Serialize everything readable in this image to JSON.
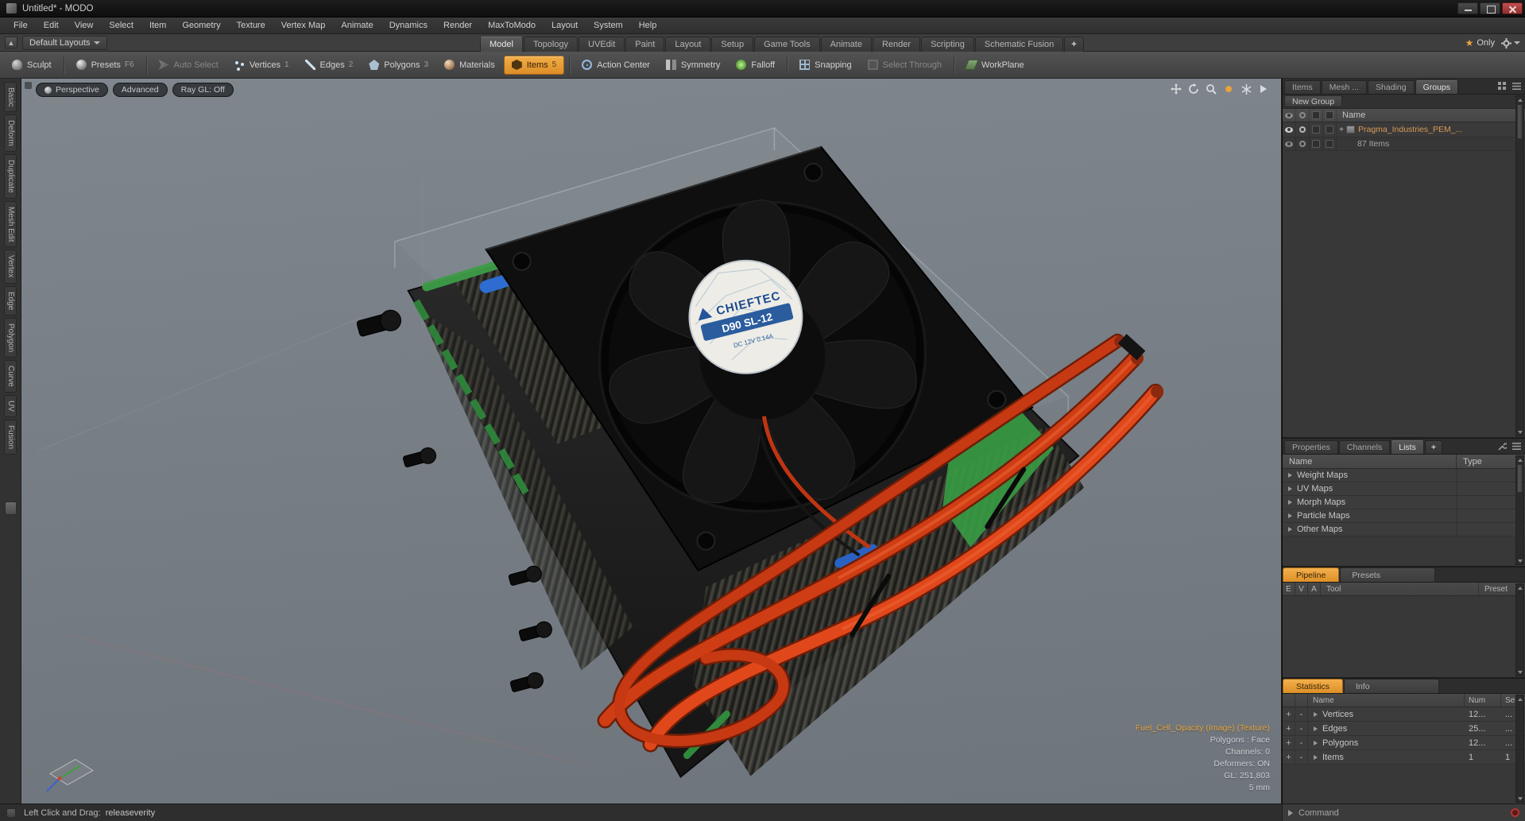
{
  "window": {
    "title": "Untitled* - MODO"
  },
  "menubar": {
    "items": [
      "File",
      "Edit",
      "View",
      "Select",
      "Item",
      "Geometry",
      "Texture",
      "Vertex Map",
      "Animate",
      "Dynamics",
      "Render",
      "MaxToModo",
      "Layout",
      "System",
      "Help"
    ]
  },
  "layoutbar": {
    "layout_selector": "Default Layouts",
    "tabs": [
      "Model",
      "Topology",
      "UVEdit",
      "Paint",
      "Layout",
      "Setup",
      "Game Tools",
      "Animate",
      "Render",
      "Scripting",
      "Schematic Fusion"
    ],
    "add_tab": "+",
    "only": "Only"
  },
  "toolbar": {
    "buttons": [
      {
        "label": "Sculpt"
      },
      {
        "label": "Presets",
        "hotkey": "F6"
      },
      {
        "label": "Auto Select"
      },
      {
        "label": "Vertices",
        "hotkey": "1"
      },
      {
        "label": "Edges",
        "hotkey": "2"
      },
      {
        "label": "Polygons",
        "hotkey": "3"
      },
      {
        "label": "Materials"
      },
      {
        "label": "Items",
        "hotkey": "5"
      },
      {
        "label": "Action Center"
      },
      {
        "label": "Symmetry"
      },
      {
        "label": "Falloff"
      },
      {
        "label": "Snapping"
      },
      {
        "label": "Select Through"
      },
      {
        "label": "WorkPlane"
      }
    ]
  },
  "left_rail": {
    "tabs": [
      "Basic",
      "Deform",
      "Duplicate",
      "Mesh Edit",
      "Vertex",
      "Edge",
      "Polygon",
      "Curve",
      "UV",
      "Fusion"
    ]
  },
  "viewport": {
    "controls": [
      "Perspective",
      "Advanced",
      "Ray GL: Off"
    ],
    "info": {
      "texture": "Fuel_Cell_Opacity (Image) (Texture)",
      "lines": [
        "Polygons : Face",
        "Channels: 0",
        "Deformers: ON",
        "GL: 251,803",
        "5 mm"
      ]
    },
    "model": {
      "fan_brand": "CHIEFTEC",
      "fan_model": "D90 SL-12",
      "fan_spec": "DC 12V 0.14A"
    }
  },
  "right_panel": {
    "groups": {
      "tabs": [
        "Items",
        "Mesh ...",
        "Shading",
        "Groups"
      ],
      "new_group": "New Group",
      "name_col": "Name",
      "expander": "+",
      "item_label": "Pragma_Industries_PEM_...",
      "item_count": "87 Items"
    },
    "lists": {
      "tabs": [
        "Properties",
        "Channels",
        "Lists"
      ],
      "add_tab": "+",
      "cols": {
        "name": "Name",
        "type": "Type"
      },
      "rows": [
        "Weight Maps",
        "UV Maps",
        "Morph Maps",
        "Particle Maps",
        "Other Maps"
      ]
    },
    "pipeline": {
      "title": "Pipeline",
      "alt_tab": "Presets",
      "cols": {
        "e": "E",
        "v": "V",
        "a": "A",
        "tool": "Tool",
        "preset": "Preset"
      }
    },
    "statistics": {
      "title": "Statistics",
      "alt_tab": "Info",
      "cols": {
        "name": "Name",
        "num": "Num",
        "sel": "Sel"
      },
      "plus": "+",
      "minus": "-",
      "rows": [
        {
          "name": "Vertices",
          "num": "12...",
          "sel": "..."
        },
        {
          "name": "Edges",
          "num": "25...",
          "sel": "..."
        },
        {
          "name": "Polygons",
          "num": "12...",
          "sel": "..."
        },
        {
          "name": "Items",
          "num": "1",
          "sel": "1"
        }
      ]
    },
    "command": {
      "label": "Command"
    }
  },
  "statusbar": {
    "prefix": "Left Click and Drag:",
    "action": "releaseverity"
  }
}
